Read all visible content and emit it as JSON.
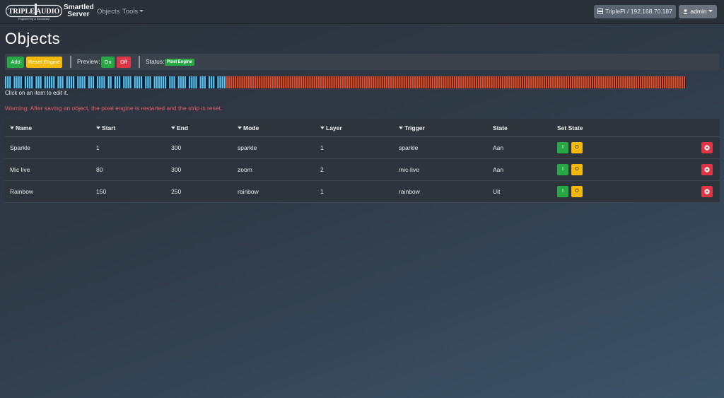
{
  "nav": {
    "logo_main": "TRIPLE AUDIO",
    "logo_sub": "Engineering & Broadcast",
    "brand_line1": "Smartled",
    "brand_line2": "Server",
    "links": {
      "objects": "Objects",
      "tools": "Tools"
    },
    "server_label": "TriplePi / 192.168.70.187",
    "user_label": "admin"
  },
  "page": {
    "title": "Objects"
  },
  "toolbar": {
    "add_label": "Add",
    "reset_label": "Reset Engine",
    "preview_label": "Preview:",
    "on_label": "On",
    "off_label": "Off",
    "status_label": "Status:",
    "status_value": "Pixel Engine"
  },
  "strip": {
    "active_color": "#5bc0eb",
    "dark_color": "#0b1f33",
    "idle_color": "#ea4b1e",
    "pattern": "11101111011110111011111011101111011110111011110110111011110111101110111111011101111011110111011101111",
    "idle_count": 210
  },
  "hint": "Click on an item to edit it.",
  "warning": "Warning: After saving an object, the pixel engine is restarted and the strip is reset.",
  "table": {
    "headers": {
      "name": "Name",
      "start": "Start",
      "end": "End",
      "mode": "Mode",
      "layer": "Layer",
      "trigger": "Trigger",
      "state": "State",
      "set_state": "Set State"
    },
    "on_symbol": "I",
    "off_symbol": "O",
    "rows": [
      {
        "name": "Sparkle",
        "start": "1",
        "end": "300",
        "mode": "sparkle",
        "layer": "1",
        "trigger": "sparkle",
        "state": "Aan"
      },
      {
        "name": "Mic live",
        "start": "80",
        "end": "300",
        "mode": "zoom",
        "layer": "2",
        "trigger": "mic-live",
        "state": "Aan"
      },
      {
        "name": "Rainbow",
        "start": "150",
        "end": "250",
        "mode": "rainbow",
        "layer": "1",
        "trigger": "rainbow",
        "state": "Uit"
      }
    ]
  },
  "colors": {
    "success": "#28a745",
    "warning": "#f0b90b",
    "danger": "#dc3545",
    "warning_text": "#e35d6a"
  },
  "icons": {
    "server": "server-icon",
    "user": "user-icon",
    "delete": "times-circle-icon"
  }
}
